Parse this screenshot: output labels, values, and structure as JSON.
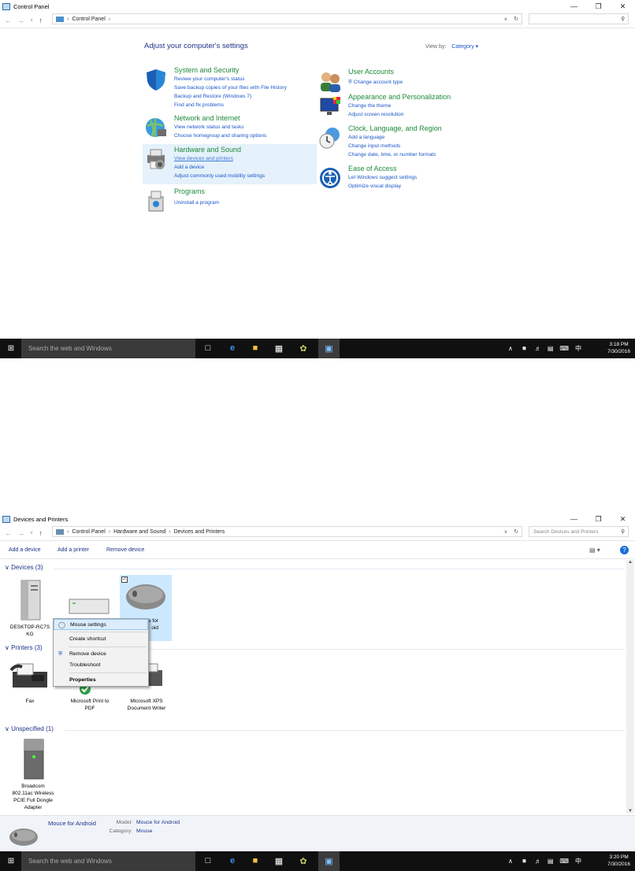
{
  "top": {
    "window_title": "Control Panel",
    "breadcrumb": [
      "Control Panel"
    ],
    "heading": "Adjust your computer's settings",
    "view_by_label": "View by:",
    "view_by_value": "Category",
    "categories": [
      {
        "title": "System and Security",
        "icon": "shield-icon",
        "links": [
          "Review your computer's status",
          "Save backup copies of your files with File History",
          "Backup and Restore (Windows 7)",
          "Find and fix problems"
        ]
      },
      {
        "title": "Network and Internet",
        "icon": "globe-network-icon",
        "links": [
          "View network status and tasks",
          "Choose homegroup and sharing options"
        ]
      },
      {
        "title": "Hardware and Sound",
        "icon": "printer-speaker-icon",
        "links": [
          "View devices and printers",
          "Add a device",
          "Adjust commonly used mobility settings"
        ]
      },
      {
        "title": "Programs",
        "icon": "programs-box-icon",
        "links": [
          "Uninstall a program"
        ]
      },
      {
        "title": "User Accounts",
        "icon": "users-icon",
        "links": [
          "Change account type"
        ]
      },
      {
        "title": "Appearance and Personalization",
        "icon": "monitor-palette-icon",
        "links": [
          "Change the theme",
          "Adjust screen resolution"
        ]
      },
      {
        "title": "Clock, Language, and Region",
        "icon": "clock-globe-icon",
        "links": [
          "Add a language",
          "Change input methods",
          "Change date, time, or number formats"
        ]
      },
      {
        "title": "Ease of Access",
        "icon": "ease-of-access-icon",
        "links": [
          "Let Windows suggest settings",
          "Optimize visual display"
        ]
      }
    ]
  },
  "taskbar_top": {
    "search_placeholder": "Search the web and Windows",
    "time": "3:18 PM",
    "date": "7/30/2016",
    "ime": "中"
  },
  "bottom": {
    "window_title": "Devices and Printers",
    "breadcrumb": [
      "Control Panel",
      "Hardware and Sound",
      "Devices and Printers"
    ],
    "search_placeholder": "Search Devices and Printers",
    "toolbar": [
      "Add a device",
      "Add a printer",
      "Remove device"
    ],
    "groups": {
      "devices": "Devices (3)",
      "printers": "Printers (3)",
      "unspecified": "Unspecified (1)"
    },
    "devices": [
      {
        "name": "DESKTOP-RC7S\nKG",
        "icon": "computer-tower-icon"
      },
      {
        "name": "",
        "icon": "keyboard-device-icon"
      },
      {
        "name": "e for\noid",
        "icon": "mouse-icon"
      }
    ],
    "printers": [
      {
        "name": "Fax",
        "icon": "fax-icon"
      },
      {
        "name": "Microsoft Print to\nPDF",
        "icon": "printer-icon"
      },
      {
        "name": "Microsoft XPS\nDocument Writer",
        "icon": "printer-icon"
      }
    ],
    "unspecified": [
      {
        "name": "Broadcom\n802.11ac Wireless\nPCIE Full Dongle\nAdapter",
        "icon": "device-box-icon"
      }
    ],
    "context_menu": [
      "Mouse settings",
      "Create shortcut",
      "Remove device",
      "Troubleshoot",
      "Properties"
    ],
    "details": {
      "name": "Mouce for Android",
      "model_label": "Model:",
      "model_value": "Mouce for Android",
      "category_label": "Category:",
      "category_value": "Mouse"
    }
  },
  "taskbar_bottom": {
    "search_placeholder": "Search the web and Windows",
    "time": "3:20 PM",
    "date": "7/30/2016",
    "ime": "中"
  }
}
